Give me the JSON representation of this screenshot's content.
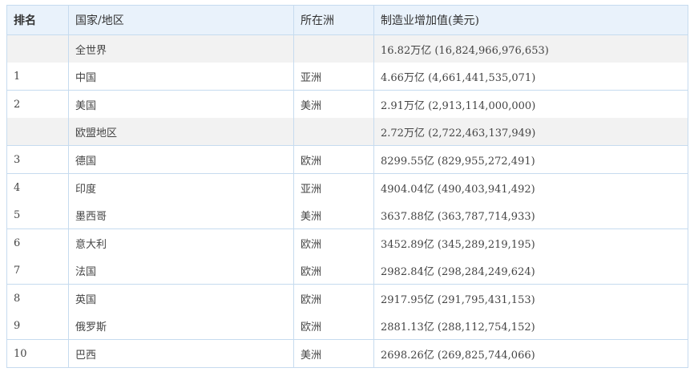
{
  "headers": {
    "rank": "排名",
    "country": "国家/地区",
    "continent": "所在洲",
    "value": "制造业增加值(美元)"
  },
  "rows": [
    {
      "rank": "",
      "country": "全世界",
      "continent": "",
      "value": "16.82万亿 (16,824,966,976,653)"
    },
    {
      "rank": "1",
      "country": "中国",
      "continent": "亚洲",
      "value": "4.66万亿 (4,661,441,535,071)"
    },
    {
      "rank": "2",
      "country": "美国",
      "continent": "美洲",
      "value": "2.91万亿 (2,913,114,000,000)"
    },
    {
      "rank": "",
      "country": "欧盟地区",
      "continent": "",
      "value": "2.72万亿 (2,722,463,137,949)"
    },
    {
      "rank": "3",
      "country": "德国",
      "continent": "欧洲",
      "value": "8299.55亿 (829,955,272,491)"
    },
    {
      "rank": "4",
      "country": "印度",
      "continent": "亚洲",
      "value": "4904.04亿 (490,403,941,492)"
    },
    {
      "rank": "5",
      "country": "墨西哥",
      "continent": "美洲",
      "value": "3637.88亿 (363,787,714,933)"
    },
    {
      "rank": "6",
      "country": "意大利",
      "continent": "欧洲",
      "value": "3452.89亿 (345,289,219,195)"
    },
    {
      "rank": "7",
      "country": "法国",
      "continent": "欧洲",
      "value": "2982.84亿 (298,284,249,624)"
    },
    {
      "rank": "8",
      "country": "英国",
      "continent": "欧洲",
      "value": "2917.95亿 (291,795,431,153)"
    },
    {
      "rank": "9",
      "country": "俄罗斯",
      "continent": "欧洲",
      "value": "2881.13亿 (288,112,754,152)"
    },
    {
      "rank": "10",
      "country": "巴西",
      "continent": "美洲",
      "value": "2698.26亿 (269,825,744,066)"
    }
  ]
}
